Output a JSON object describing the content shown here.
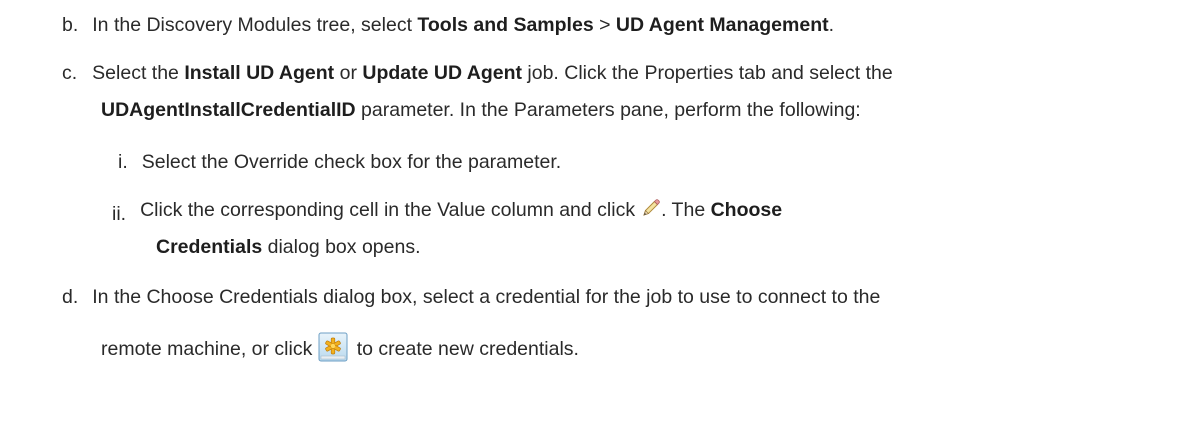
{
  "steps": {
    "b": {
      "marker": "b.",
      "t1": "In the Discovery Modules tree, select ",
      "b1": "Tools and Samples",
      "t2": " > ",
      "b2": "UD Agent Management",
      "t3": "."
    },
    "c": {
      "marker": "c.",
      "l1_t1": "Select the ",
      "l1_b1": "Install UD Agent",
      "l1_t2": " or ",
      "l1_b2": "Update UD Agent",
      "l1_t3": " job. Click the Properties tab and select the",
      "l2_b1": "UDAgentInstallCredentialID",
      "l2_t1": " parameter. In the Parameters pane, perform the following:"
    },
    "i": {
      "marker": "i.",
      "text": "Select the Override check box for the parameter."
    },
    "ii": {
      "marker": "ii.",
      "l1_t1": "Click the corresponding cell in the Value column and click",
      "l1_t2": ". The ",
      "l1_b1": "Choose",
      "l2_b1": "Credentials",
      "l2_t1": " dialog box opens."
    },
    "d": {
      "marker": "d.",
      "l1_t1": "In the Choose Credentials dialog box, select a credential for the job to use to connect to the",
      "l2_t1": "remote machine, or click",
      "l2_t2": " to create new credentials."
    }
  },
  "icons": {
    "edit": "pencil-icon",
    "new_credentials": "new-credentials-icon"
  }
}
